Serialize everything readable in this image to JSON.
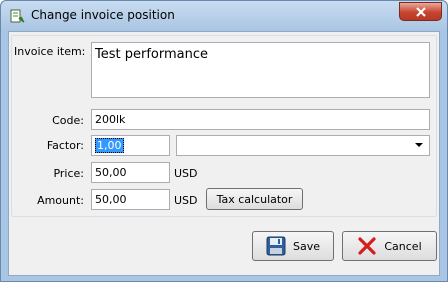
{
  "window": {
    "title": "Change invoice position",
    "app_icon": "invoice-app-icon",
    "close_icon": "close-icon"
  },
  "form": {
    "invoice_item_label": "Invoice item:",
    "invoice_item_value": "Test performance",
    "code_label": "Code:",
    "code_value": "200lk",
    "factor_label": "Factor:",
    "factor_value": "1,00",
    "factor_unit_value": "",
    "price_label": "Price:",
    "price_value": "50,00",
    "price_currency": "USD",
    "amount_label": "Amount:",
    "amount_value": "50,00",
    "amount_currency": "USD",
    "tax_calculator_label": "Tax calculator"
  },
  "buttons": {
    "save_label": "Save",
    "save_icon": "floppy-disk-icon",
    "cancel_label": "Cancel",
    "cancel_icon": "red-x-icon"
  }
}
